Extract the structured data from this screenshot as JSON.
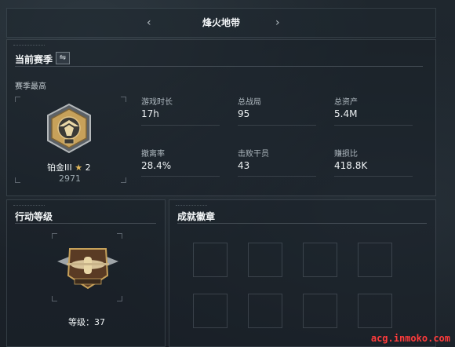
{
  "nav": {
    "title": "烽火地带",
    "prev": "‹",
    "next": "›"
  },
  "season": {
    "header": "当前赛季",
    "swap_icon": "⇋",
    "best_label": "赛季最高",
    "rank_name": "铂金III",
    "star_glyph": "★",
    "stars": "2",
    "score": "2971",
    "stats": [
      {
        "label": "游戏时长",
        "value": "17h"
      },
      {
        "label": "总战局",
        "value": "95"
      },
      {
        "label": "总资产",
        "value": "5.4M"
      },
      {
        "label": "撤离率",
        "value": "28.4%"
      },
      {
        "label": "击败干员",
        "value": "43"
      },
      {
        "label": "赚损比",
        "value": "418.8K"
      }
    ]
  },
  "action_level": {
    "header": "行动等级",
    "level_text": "等级：37"
  },
  "achievements": {
    "header": "成就徽章"
  },
  "watermark": "acg.inmoko.com",
  "colors": {
    "gold": "#c7a15a",
    "accent_star": "#e2b75a",
    "watermark": "#ff3b3b"
  }
}
